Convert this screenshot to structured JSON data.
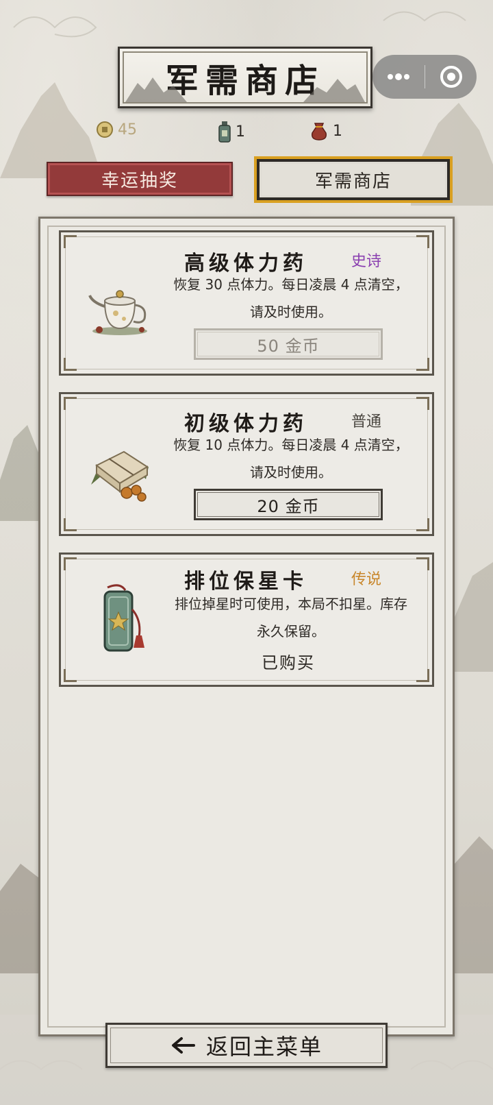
{
  "header": {
    "title": "军需商店"
  },
  "capsule": {
    "menu_icon": "more-dots-icon",
    "close_icon": "target-circle-icon"
  },
  "resources": {
    "gold": "45",
    "potion": "1",
    "bag": "1"
  },
  "tabs": [
    {
      "label": "幸运抽奖",
      "active": false
    },
    {
      "label": "军需商店",
      "active": true
    }
  ],
  "items": [
    {
      "name": "高级体力药",
      "rarity": "史诗",
      "rarity_color": "#8a3fb0",
      "description": "恢复 30 点体力。每日凌晨 4 点清空，请及时使用。",
      "price": "50 金币",
      "affordable": false,
      "icon": "teapot-icon"
    },
    {
      "name": "初级体力药",
      "rarity": "普通",
      "rarity_color": "#4a4640",
      "description": "恢复 10 点体力。每日凌晨 4 点清空，请及时使用。",
      "price": "20 金币",
      "affordable": true,
      "icon": "herb-package-icon"
    },
    {
      "name": "排位保星卡",
      "rarity": "传说",
      "rarity_color": "#c8862a",
      "description": "排位掉星时可使用，本局不扣星。库存永久保留。",
      "status": "已购买",
      "icon": "jade-token-icon"
    }
  ],
  "footer": {
    "back_label": "返回主菜单"
  }
}
